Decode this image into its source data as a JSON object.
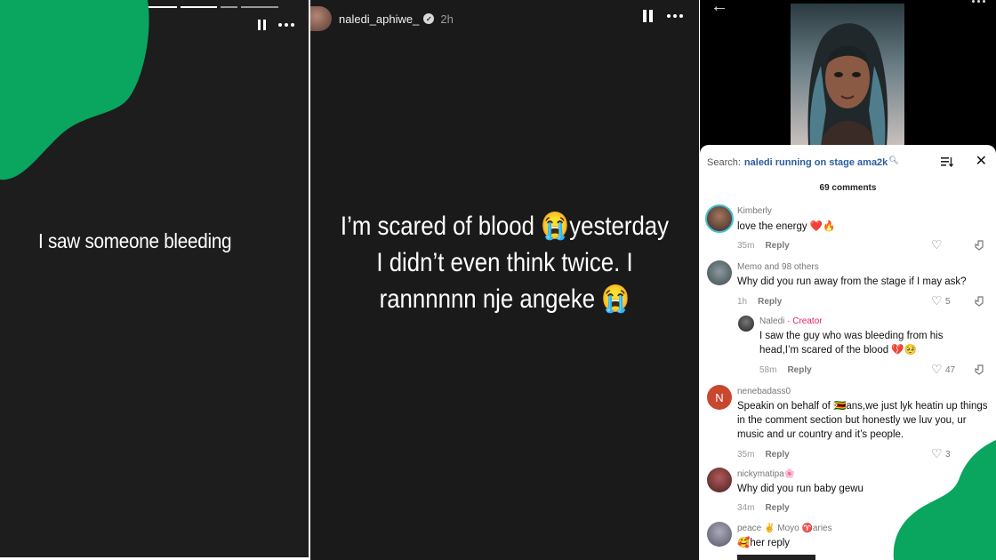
{
  "panel1": {
    "story_text": "I saw someone bleeding"
  },
  "panel2": {
    "username": "naledi_aphiwe_",
    "time": "2h",
    "story_text": "I’m scared of blood 😭yesterday I didn’t even think twice. I rannnnnn nje angeke 😭"
  },
  "panel3": {
    "search_label": "Search:",
    "search_query": "naledi running on stage ama2k",
    "comment_count": "69 comments",
    "comments": [
      {
        "author": "Kimberly",
        "text": "love the energy ❤️🔥",
        "time": "35m",
        "reply": "Reply",
        "likes": ""
      },
      {
        "author": "Memo and 98 others",
        "text": "Why did you run away from the stage if I may ask?",
        "time": "1h",
        "reply": "Reply",
        "likes": "5"
      },
      {
        "author": "Naledi",
        "badge": "· Creator",
        "text": "I saw the guy who was bleeding from his head,I’m scared of the blood 💔🥺",
        "time": "58m",
        "reply": "Reply",
        "likes": "47"
      },
      {
        "author": "nenebadass0",
        "avatar_letter": "N",
        "text": "Speakin on behalf of 🇿🇼ans,we just lyk heatin up things in the comment section but honestly we luv you, ur music and ur country and it’s people.",
        "time": "35m",
        "reply": "Reply",
        "likes": "3"
      },
      {
        "author": "nickymatipa🌸",
        "text": "Why did you run baby gewu",
        "time": "34m",
        "reply": "Reply",
        "likes": ""
      },
      {
        "author": "peace ✌️ Moyo ♈aries",
        "text": "🥰her reply",
        "time": "",
        "reply": "",
        "likes": ""
      }
    ]
  },
  "colors": {
    "brand_green": "#0aa55e",
    "creator_pink": "#e0245e",
    "search_blue": "#2a5d9f"
  }
}
